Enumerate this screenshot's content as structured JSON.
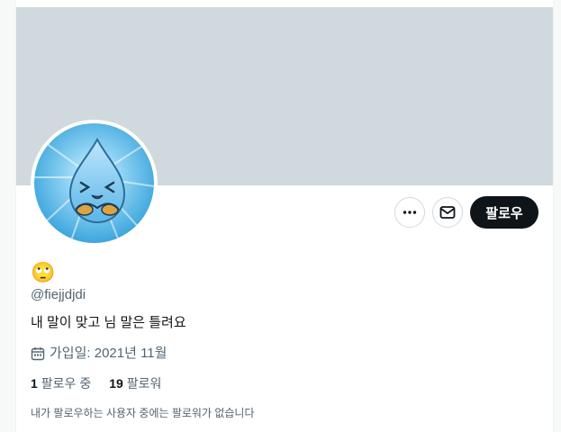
{
  "profile": {
    "display_emoji": "🙄",
    "handle": "@fiejjdjdi",
    "bio": "내 말이 맞고 님 말은 틀려요",
    "joined": "가입일: 2021년 11월",
    "following_count": "1",
    "following_label": "팔로우 중",
    "followers_count": "19",
    "followers_label": "팔로워",
    "mutual_note": "내가 팔로우하는 사용자 중에는 팔로워가 없습니다"
  },
  "actions": {
    "more_icon": "more-dots-icon",
    "message_icon": "mail-icon",
    "follow_label": "팔로우"
  },
  "colors": {
    "banner": "#cfd9de",
    "text_primary": "#0f1419",
    "text_secondary": "#536471",
    "follow_button": "#0f1419"
  }
}
